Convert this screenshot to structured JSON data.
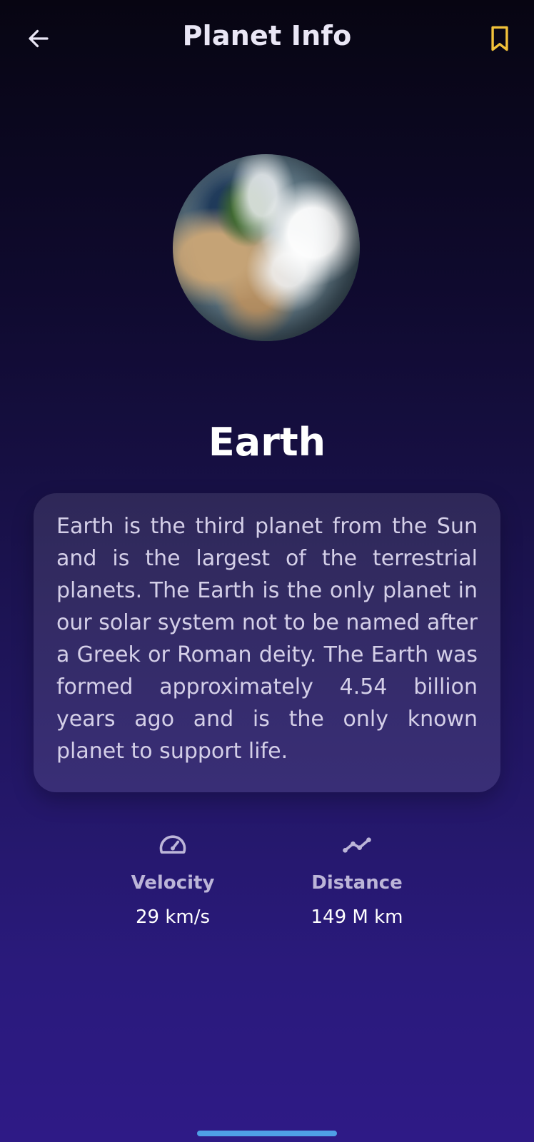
{
  "header": {
    "title": "Planet Info",
    "back_icon": "arrow-left-icon",
    "bookmark_icon": "bookmark-icon",
    "bookmark_color": "#f2c23a"
  },
  "planet": {
    "name": "Earth",
    "description": "Earth is the third planet from the Sun and is the largest of the terrestrial planets. The Earth is the only planet in our solar system not to be named after a Greek or Roman deity. The Earth was formed approximately 4.54 billion years ago and is the only known planet to support life."
  },
  "stats": [
    {
      "icon": "speedometer-icon",
      "label": "Velocity",
      "value": "29 km/s"
    },
    {
      "icon": "line-chart-icon",
      "label": "Distance",
      "value": "149 M km"
    }
  ],
  "colors": {
    "background_top": "#070512",
    "background_bottom": "#2e1a86",
    "accent": "#f2c23a",
    "home_indicator": "#4f9fe6"
  }
}
